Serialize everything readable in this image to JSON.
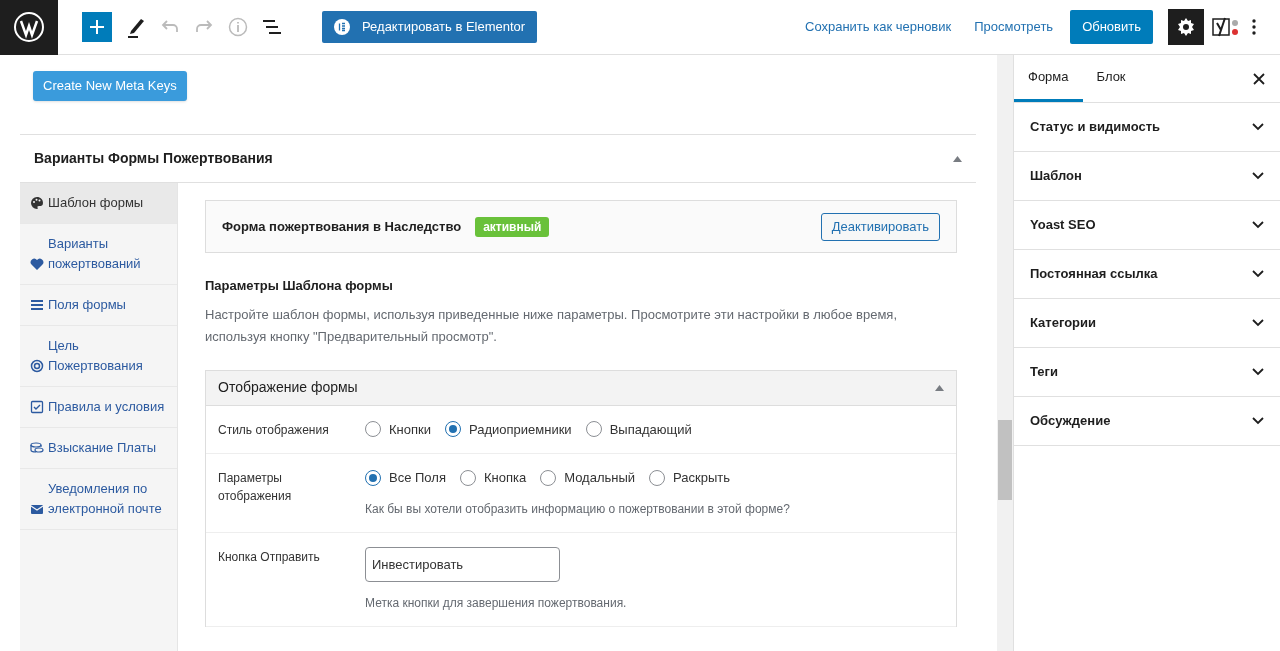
{
  "toolbar": {
    "elementor_button": "Редактировать в Elementor",
    "save_draft": "Сохранить как черновик",
    "preview": "Просмотреть",
    "update": "Обновить"
  },
  "meta_keys_button": "Create New Meta Keys",
  "metabox": {
    "title": "Варианты Формы Пожертвования",
    "expanded": true,
    "nav": [
      {
        "label": "Шаблон формы",
        "selected": true
      },
      {
        "label": "Варианты пожертвований",
        "selected": false
      },
      {
        "label": "Поля формы",
        "selected": false
      },
      {
        "label": "Цель Пожертвования",
        "selected": false
      },
      {
        "label": "Правила и условия",
        "selected": false
      },
      {
        "label": "Взыскание Платы",
        "selected": false
      },
      {
        "label": "Уведомления по электронной почте",
        "selected": false
      }
    ],
    "template": {
      "name": "Форма пожертвования в Наследство",
      "badge": "активный",
      "button": "Деактивировать"
    },
    "settings_title": "Параметры Шаблона формы",
    "settings_desc": "Настройте шаблон формы, используя приведенные ниже параметры. Просмотрите эти настройки в любое время, используя кнопку \"Предварительный просмотр\".",
    "section": {
      "title": "Отображение формы",
      "expanded": true,
      "rows": [
        {
          "kind": "radio",
          "label": "Стиль отображения",
          "options": [
            {
              "label": "Кнопки",
              "selected": false
            },
            {
              "label": "Радиоприемники",
              "selected": true
            },
            {
              "label": "Выпадающий",
              "selected": false
            }
          ]
        },
        {
          "kind": "radio",
          "label": "Параметры отображения",
          "options": [
            {
              "label": "Все Поля",
              "selected": true
            },
            {
              "label": "Кнопка",
              "selected": false
            },
            {
              "label": "Модальный",
              "selected": false
            },
            {
              "label": "Раскрыть",
              "selected": false
            }
          ],
          "help": "Как бы вы хотели отобразить информацию о пожертвовании в этой форме?"
        },
        {
          "kind": "text",
          "label": "Кнопка Отправить",
          "value": "Инвестировать",
          "help": "Метка кнопки для завершения пожертвования."
        }
      ]
    }
  },
  "sidebar": {
    "tabs": [
      {
        "label": "Форма",
        "selected": true
      },
      {
        "label": "Блок",
        "selected": false
      }
    ],
    "panels": [
      {
        "title": "Статус и видимость",
        "expanded": false
      },
      {
        "title": "Шаблон",
        "expanded": false
      },
      {
        "title": "Yoast SEO",
        "expanded": false
      },
      {
        "title": "Постоянная ссылка",
        "expanded": false
      },
      {
        "title": "Категории",
        "expanded": false
      },
      {
        "title": "Теги",
        "expanded": false
      },
      {
        "title": "Обсуждение",
        "expanded": false
      }
    ]
  }
}
